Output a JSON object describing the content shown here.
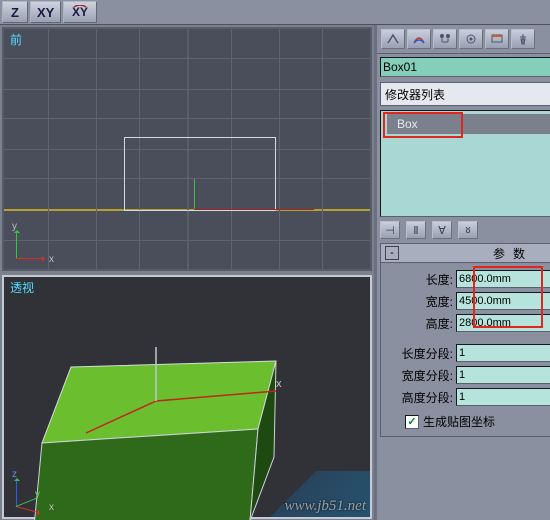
{
  "toolbar": {
    "z_label": "Z",
    "xy_label": "XY",
    "xy2_label": "XY"
  },
  "viewport": {
    "front_label": "前",
    "persp_label": "透视"
  },
  "command_panel": {
    "icons": [
      "arrow",
      "rainbow",
      "link",
      "loop",
      "sphere",
      "display",
      "hammer"
    ]
  },
  "object": {
    "name": "Box01",
    "color": "#38d028"
  },
  "modifier": {
    "combo_label": "修改器列表",
    "stack_item": "Box"
  },
  "stack_tools": [
    "pin",
    "stack",
    "show-end",
    "unique",
    "remove",
    "config"
  ],
  "rollout": {
    "title": "参数",
    "rows": [
      {
        "label": "长度:",
        "value": "6800.0mm"
      },
      {
        "label": "宽度:",
        "value": "4500.0mm"
      },
      {
        "label": "高度:",
        "value": "2800.0mm"
      },
      {
        "label": "长度分段:",
        "value": "1"
      },
      {
        "label": "宽度分段:",
        "value": "1"
      },
      {
        "label": "高度分段:",
        "value": "1"
      }
    ],
    "checkbox_label": "生成贴图坐标"
  },
  "watermark": "www.jb51.net"
}
